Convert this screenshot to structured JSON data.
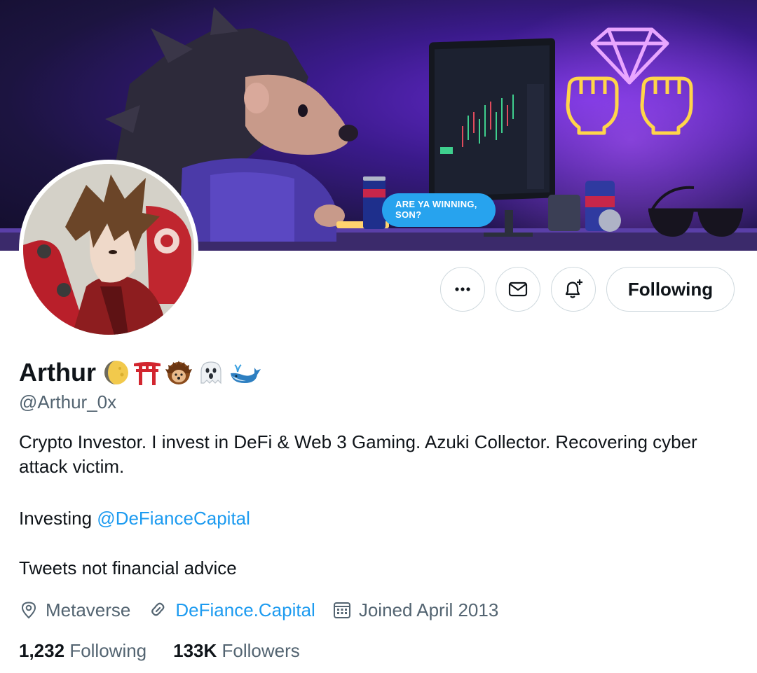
{
  "banner": {
    "bubble_line1": "ARE YA WINNING,",
    "bubble_line2": "SON?",
    "icons": [
      "hedgehog-mascot",
      "trading-monitor",
      "neon-diamond-icon",
      "neon-raised-fists-icon",
      "soda-can",
      "sunglasses"
    ]
  },
  "avatar": {
    "icon": "anime-character-skateboard-avatar"
  },
  "actions": {
    "more_icon": "more-horizontal-icon",
    "message_icon": "envelope-icon",
    "notify_icon": "bell-plus-icon",
    "follow_label": "Following"
  },
  "profile": {
    "display_name": "Arthur",
    "name_emojis": [
      "crescent-moon-icon",
      "torii-gate-icon",
      "hedgehog-icon",
      "ghost-icon",
      "whale-icon"
    ],
    "handle": "@Arthur_0x"
  },
  "bio": {
    "line1": "Crypto Investor. I invest in DeFi & Web 3 Gaming. Azuki Collector. Recovering cyber attack victim.",
    "line2_prefix": "Investing ",
    "line2_mention": "@DeFianceCapital",
    "line3": "Tweets not financial advice"
  },
  "meta": {
    "location": "Metaverse",
    "website": "DeFiance.Capital",
    "joined": "Joined April 2013"
  },
  "stats": {
    "following_count": "1,232",
    "following_label": "Following",
    "followers_count": "133K",
    "followers_label": "Followers"
  },
  "colors": {
    "link": "#1d9bf0",
    "secondary_text": "#536471",
    "primary_text": "#0f1419",
    "border": "#cfd9de",
    "bubble": "#27a3ee"
  }
}
